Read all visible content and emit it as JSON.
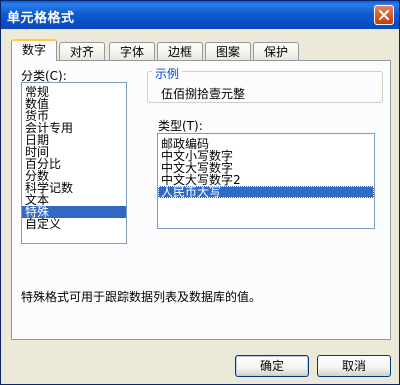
{
  "window": {
    "title": "单元格格式"
  },
  "tabs": [
    {
      "label": "数字"
    },
    {
      "label": "对齐"
    },
    {
      "label": "字体"
    },
    {
      "label": "边框"
    },
    {
      "label": "图案"
    },
    {
      "label": "保护"
    }
  ],
  "category": {
    "label": "分类(C):",
    "items": [
      "常规",
      "数值",
      "货币",
      "会计专用",
      "日期",
      "时间",
      "百分比",
      "分数",
      "科学记数",
      "文本",
      "特殊",
      "自定义"
    ],
    "selected": "特殊"
  },
  "sample": {
    "title": "示例",
    "value": "伍佰捌拾壹元整"
  },
  "type": {
    "label": "类型(T):",
    "items": [
      "邮政编码",
      "中文小写数字",
      "中文大写数字",
      "中文大写数字2",
      "人民币大写"
    ],
    "selected": "人民币大写"
  },
  "description": "特殊格式可用于跟踪数据列表及数据库的值。",
  "buttons": {
    "ok": "确定",
    "cancel": "取消"
  }
}
